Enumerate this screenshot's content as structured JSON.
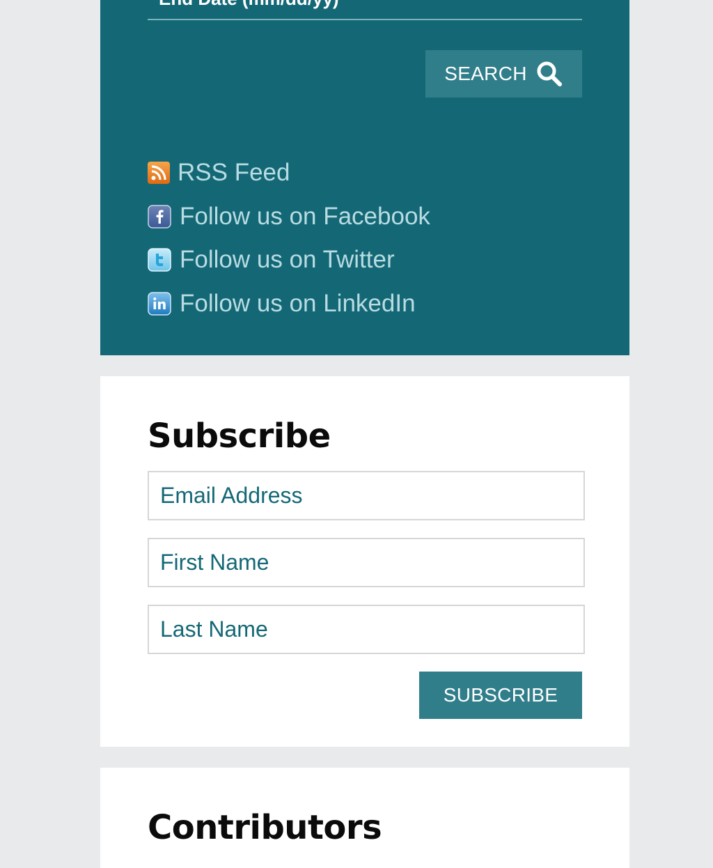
{
  "search_panel": {
    "end_date_placeholder": "End Date (mm/dd/yy)",
    "search_button_label": "SEARCH",
    "search_icon": "magnifier-icon",
    "social_links": [
      {
        "label": "RSS Feed",
        "icon": "rss-icon",
        "icon_color": "#f08a24"
      },
      {
        "label": "Follow us on Facebook",
        "icon": "facebook-icon",
        "icon_color": "#3b5998"
      },
      {
        "label": "Follow us on Twitter",
        "icon": "twitter-icon",
        "icon_color": "#55acee"
      },
      {
        "label": "Follow us on LinkedIn",
        "icon": "linkedin-icon",
        "icon_color": "#1f7bc1"
      }
    ]
  },
  "subscribe": {
    "title": "Subscribe",
    "email_placeholder": "Email Address",
    "first_name_placeholder": "First Name",
    "last_name_placeholder": "Last Name",
    "button_label": "SUBSCRIBE"
  },
  "contributors": {
    "title": "Contributors"
  },
  "colors": {
    "panel_background": "#146876",
    "button_background": "#317e8b",
    "link_text": "#b9dce2",
    "page_background": "#e9eaec",
    "field_text": "#146876"
  }
}
